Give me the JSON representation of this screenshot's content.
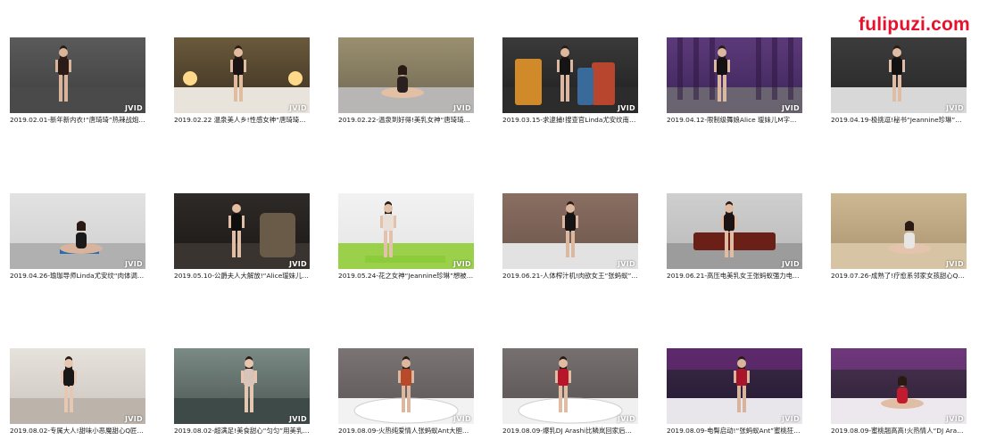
{
  "watermark": "fulipuzi.com",
  "badge_text": "JVID",
  "colors": {
    "watermark": "#e8112d",
    "caption": "#1b1b1b",
    "background": "#ffffff"
  },
  "items": [
    {
      "caption": "2019.02.01-新年新内衣!“唐琦琦”热辣战炮套…",
      "scene": "dark-wall-red"
    },
    {
      "caption": "2019.02.22 温泉美人乡!性感女神“唐琦琦77…",
      "scene": "bedroom-lamps"
    },
    {
      "caption": "2019.02.22-温泉到好得!美乳女神“唐琦琦77”…",
      "scene": "bed-window"
    },
    {
      "caption": "2019.03.15-求逮捕!搜查官Linda尤安纹南半…",
      "scene": "barrels"
    },
    {
      "caption": "2019.04.12-限制级舞娘Alice 瑷妹儿M字腿大…",
      "scene": "purple-curtain"
    },
    {
      "caption": "2019.04.19-极挑逗!秘书“Jeannine珍琳”性感…",
      "scene": "dark-bed"
    },
    {
      "caption": "2019.04.26-瑜珈导师Linda尤安纹“肉体调教”…",
      "scene": "yoga-studio"
    },
    {
      "caption": "2019.05.10-公爵夫人大解放!“Alice瑷妹儿”…",
      "scene": "ornate-chair"
    },
    {
      "caption": "2019.05.24-花之女神“Jeannine珍琳”想被注入…",
      "scene": "white-studio"
    },
    {
      "caption": "2019.06.21-人体榨汁机!肉欲女王“张蚂蚁”蜜…",
      "scene": "brick-bed"
    },
    {
      "caption": "2019.06.21-高压电美乳女王张蚂蚁强力电臀摇…",
      "scene": "leather-sofa"
    },
    {
      "caption": "2019.07.26-成熟了!疗愈系邻家女孩甜心Q匠…",
      "scene": "wood-room"
    },
    {
      "caption": "2019.08.02-专属大人!甜味小恶魔甜心Q匠献…",
      "scene": "maid-room"
    },
    {
      "caption": "2019.08.02-超满足!美食甜心“匀匀”用美乳超…",
      "scene": "kitchen"
    },
    {
      "caption": "2019.08.09-火热纯爱情人张蚂蚁Ant大胆辣袜…",
      "scene": "bathtub"
    },
    {
      "caption": "2019.08.09-爆乳DJ Arashi比鳞岚回家后化身…",
      "scene": "bathtub-2"
    },
    {
      "caption": "2019.08.09-电臀启动!“张蚂蚁Ant”蜜桃狂抖…",
      "scene": "purple-bed"
    },
    {
      "caption": "2019.08.09-蜜桃翘高高!火热情人“DJ Arashi…",
      "scene": "purple-bed-2"
    }
  ]
}
